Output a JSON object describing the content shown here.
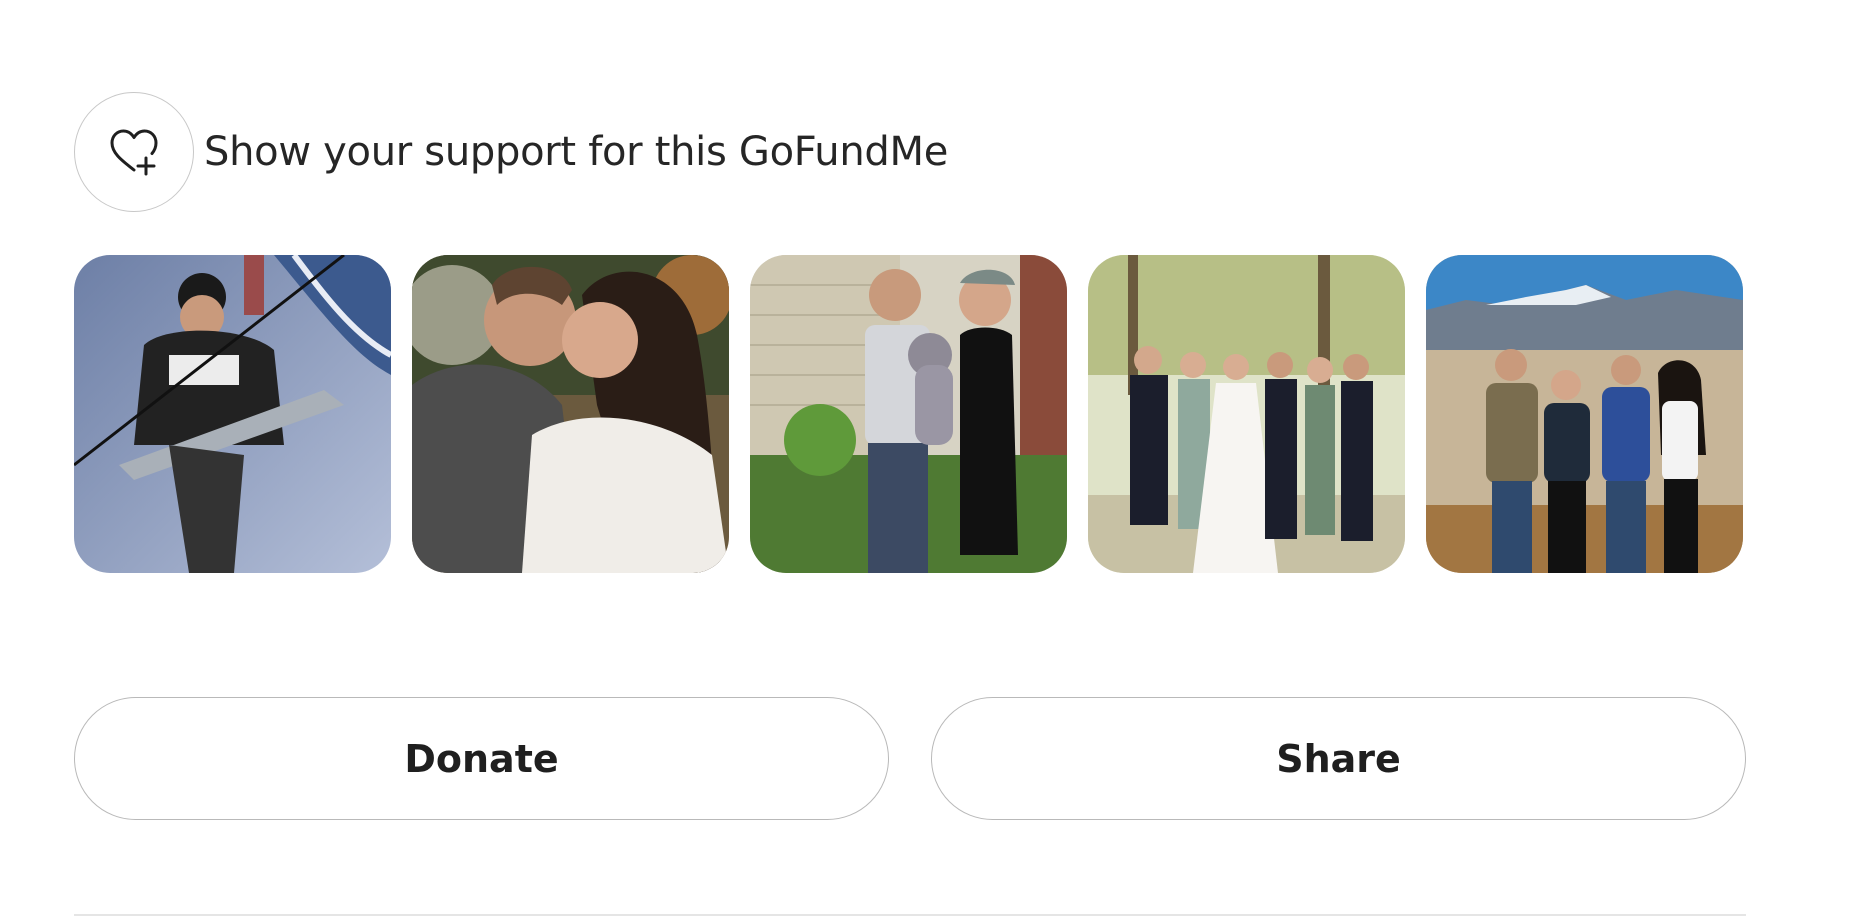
{
  "support": {
    "label": "Show your support for this GoFundMe",
    "icon": "heart-plus-icon"
  },
  "photos": [
    {
      "label": "photo-fishing"
    },
    {
      "label": "photo-couple-kiss"
    },
    {
      "label": "photo-couple-with-dog"
    },
    {
      "label": "photo-wedding-party"
    },
    {
      "label": "photo-mountains-group"
    }
  ],
  "actions": {
    "donate_label": "Donate",
    "share_label": "Share"
  },
  "colors": {
    "border": "#c8c8c8",
    "text": "#1f1f1f"
  }
}
